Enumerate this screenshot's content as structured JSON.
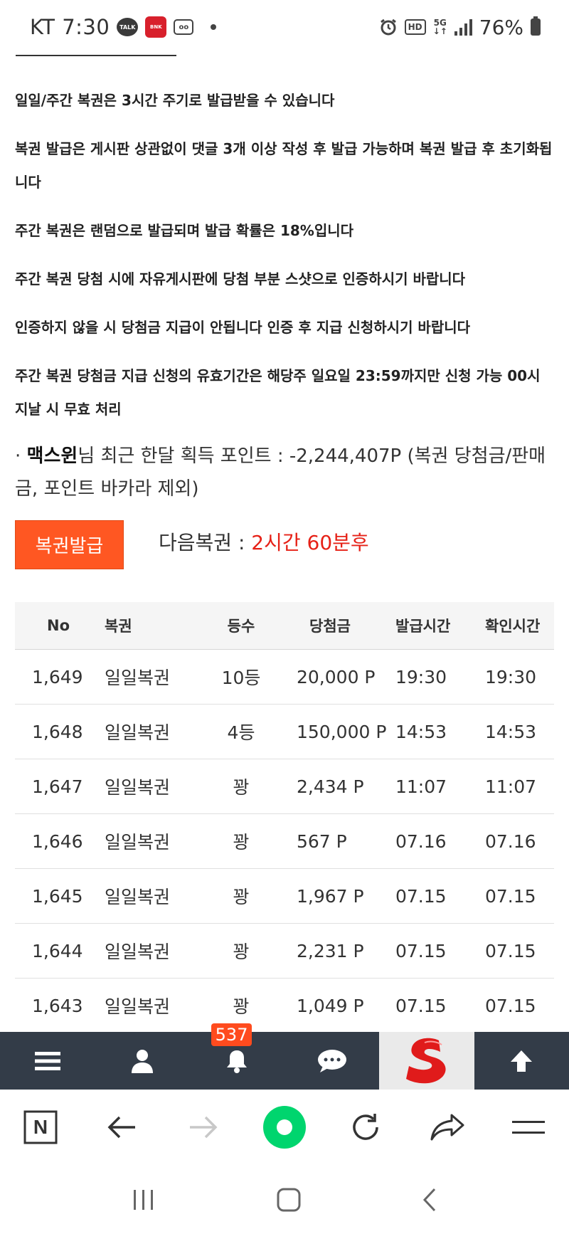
{
  "status_bar": {
    "carrier_time": "KT 7:30",
    "talk_icon_label": "TALK",
    "bnk_icon_label": "BNK",
    "battery": "76%",
    "hd_label": "HD",
    "fiveg_label": "5G"
  },
  "notices": [
    "일일/주간 복권은 3시간 주기로 발급받을 수 있습니다",
    "복권 발급은 게시판 상관없이 댓글 3개 이상 작성 후 발급 가능하며 복권 발급 후 초기화됩니다",
    "주간 복권은 랜덤으로 발급되며 발급 확률은 18%입니다",
    "주간 복권 당첨 시에 자유게시판에 당첨 부분 스샷으로 인증하시기 바랍니다",
    "인증하지 않을 시 당첨금 지급이 안됩니다 인증 후 지급 신청하시기 바랍니다",
    "주간 복권 당첨금 지급 신청의 유효기간은 해당주 일요일 23:59까지만 신청 가능 00시 지날 시 무효 처리"
  ],
  "points": {
    "bullet": "·",
    "username": "맥스윈",
    "text": "님 최근 한달 획득 포인트 : -2,244,407P (복권 당첨금/판매금, 포인트 바카라 제외)"
  },
  "lottery": {
    "issue_button": "복권발급",
    "next_label": "다음복권 : ",
    "next_value": "2시간 60분후"
  },
  "table": {
    "headers": [
      "No",
      "복권",
      "등수",
      "당첨금",
      "발급시간",
      "확인시간"
    ],
    "rows": [
      [
        "1,649",
        "일일복권",
        "10등",
        "20,000 P",
        "19:30",
        "19:30"
      ],
      [
        "1,648",
        "일일복권",
        "4등",
        "150,000 P",
        "14:53",
        "14:53"
      ],
      [
        "1,647",
        "일일복권",
        "꽝",
        "2,434 P",
        "11:07",
        "11:07"
      ],
      [
        "1,646",
        "일일복권",
        "꽝",
        "567 P",
        "07.16",
        "07.16"
      ],
      [
        "1,645",
        "일일복권",
        "꽝",
        "1,967 P",
        "07.15",
        "07.15"
      ],
      [
        "1,644",
        "일일복권",
        "꽝",
        "2,231 P",
        "07.15",
        "07.15"
      ],
      [
        "1,643",
        "일일복권",
        "꽝",
        "1,049 P",
        "07.15",
        "07.15"
      ]
    ]
  },
  "app_nav": {
    "notification_count": "537",
    "items": [
      "menu-icon",
      "user-icon",
      "bell-icon",
      "chat-icon",
      "site-logo",
      "arrow-up-icon"
    ]
  },
  "browser_bar": {
    "items": [
      "naver-n-icon",
      "back-arrow-icon",
      "forward-arrow-icon",
      "green-dot-icon",
      "refresh-icon",
      "share-icon",
      "menu-icon"
    ],
    "naver_letter": "N"
  },
  "colors": {
    "accent": "#ff5722",
    "highlight_red": "#e62117",
    "nav_bg": "#333c48",
    "green": "#00d56e"
  }
}
